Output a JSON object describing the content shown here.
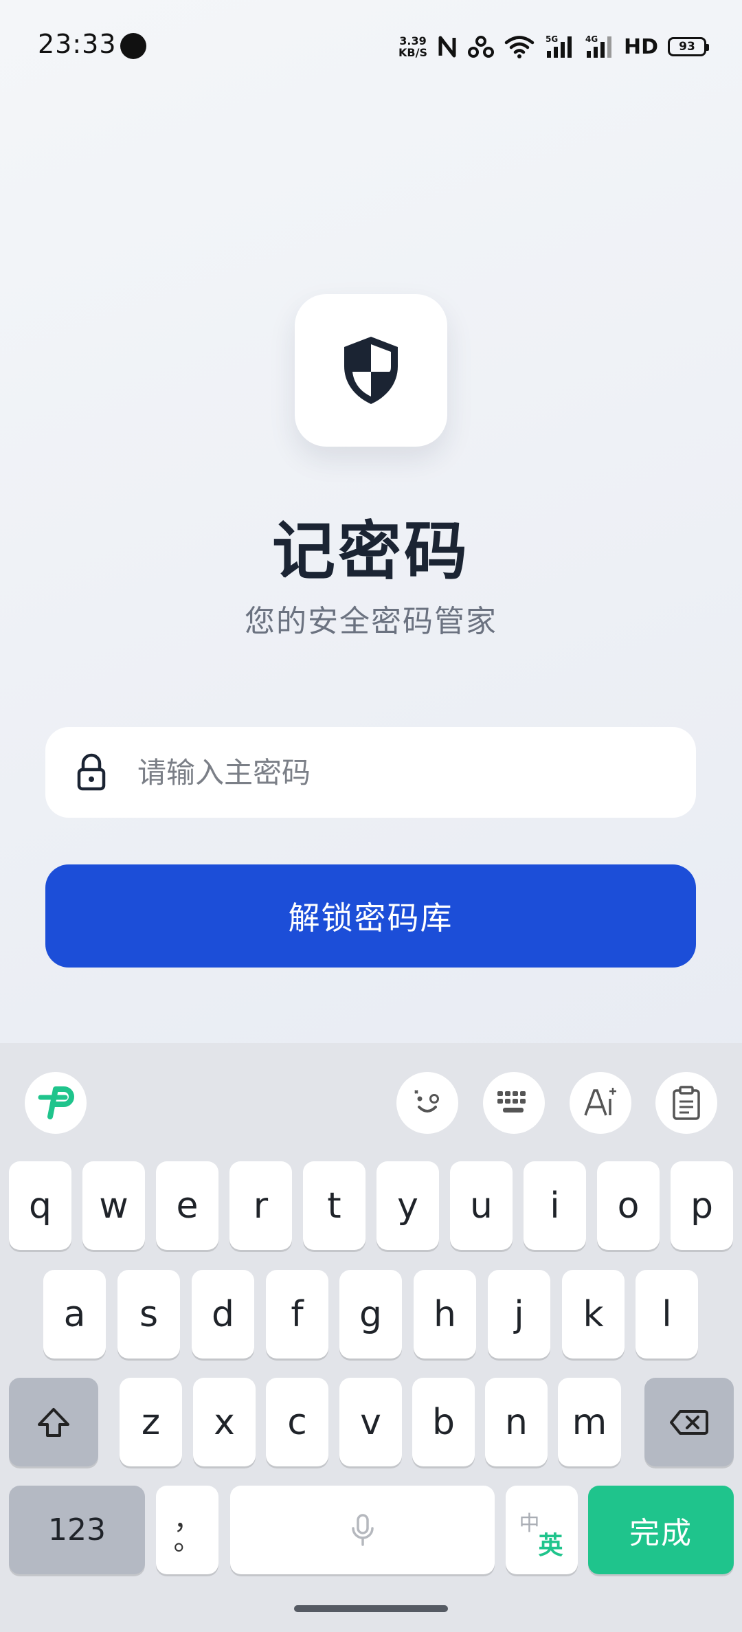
{
  "status_bar": {
    "time": "23:33",
    "net_speed_value": "3.39",
    "net_speed_unit": "KB/S",
    "hd_label": "HD",
    "battery": "93",
    "icons": [
      "nfc-icon",
      "hotspot-icon",
      "wifi-icon",
      "5g-signal-icon",
      "4g-signal-icon"
    ]
  },
  "app": {
    "logo_icon": "shield-icon",
    "title": "记密码",
    "subtitle": "您的安全密码管家",
    "password_placeholder": "请输入主密码",
    "password_icon": "lock-icon",
    "unlock_label": "解锁密码库",
    "accent_color": "#1c4ed8"
  },
  "keyboard": {
    "toolbar": [
      "ime-logo-icon",
      "emoji-icon",
      "keyboard-layout-icon",
      "ai-writing-icon",
      "clipboard-icon"
    ],
    "rows": [
      [
        "q",
        "w",
        "e",
        "r",
        "t",
        "y",
        "u",
        "i",
        "o",
        "p"
      ],
      [
        "a",
        "s",
        "d",
        "f",
        "g",
        "h",
        "j",
        "k",
        "l"
      ],
      [
        "z",
        "x",
        "c",
        "v",
        "b",
        "n",
        "m"
      ]
    ],
    "num_label": "123",
    "punct_top": "，",
    "punct_bottom": "。",
    "lang_cn": "中",
    "lang_en": "英",
    "done_label": "完成",
    "done_color": "#1fc48c"
  }
}
